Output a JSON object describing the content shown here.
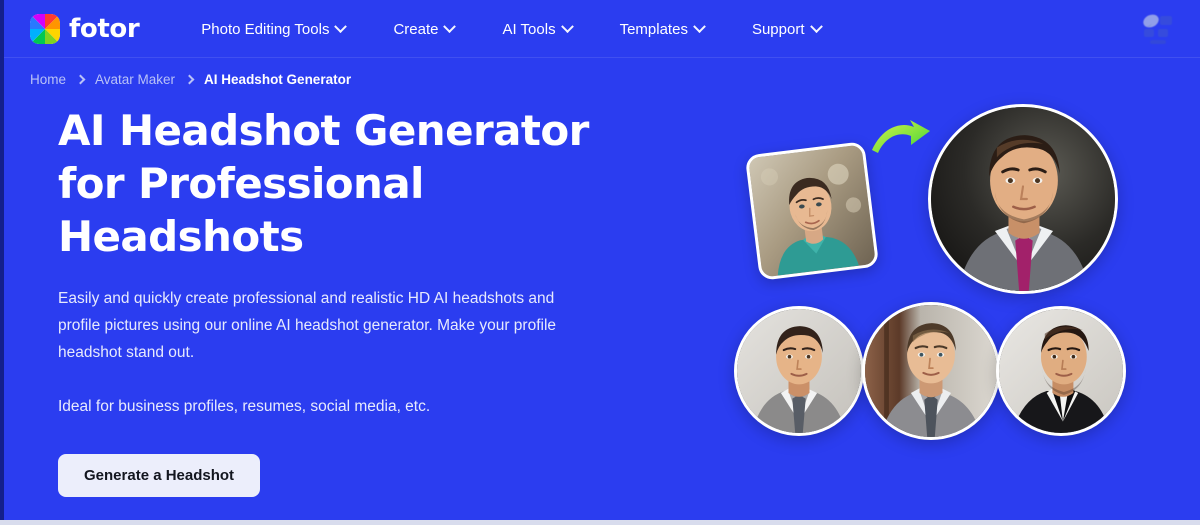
{
  "colors": {
    "background": "#2B3DF0",
    "header_bg": "#2B3DF0",
    "text_primary": "#FFFFFF",
    "text_muted": "#B9C2F7",
    "cta_bg": "#ECEEFB",
    "cta_text": "#13161F",
    "arrow_green": "#5FE03A",
    "arrow_green_light": "#C8F24A"
  },
  "header": {
    "brand_name": "fotor",
    "brand_icon": "fotor-color-wheel-logo",
    "nav_items": [
      {
        "label": "Photo Editing Tools",
        "icon": "chevron-down-icon",
        "has_dropdown": true
      },
      {
        "label": "Create",
        "icon": "chevron-down-icon",
        "has_dropdown": true
      },
      {
        "label": "AI Tools",
        "icon": "chevron-down-icon",
        "has_dropdown": true
      },
      {
        "label": "Templates",
        "icon": "chevron-down-icon",
        "has_dropdown": true
      },
      {
        "label": "Support",
        "icon": "chevron-down-icon",
        "has_dropdown": true
      }
    ],
    "account_icon": "user-avatar-icon"
  },
  "breadcrumb": {
    "separator_icon": "chevron-right-icon",
    "items": [
      {
        "label": "Home",
        "current": false
      },
      {
        "label": "Avatar Maker",
        "current": false
      },
      {
        "label": "AI Headshot Generator",
        "current": true
      }
    ]
  },
  "hero": {
    "title": "AI Headshot Generator for Professional Headshots",
    "description": "Easily and quickly create professional and realistic HD AI headshots and profile pictures using our online AI headshot generator. Make your profile headshot stand out.",
    "subtext": "Ideal for business profiles, resumes, social media, etc.",
    "cta_label": "Generate a Headshot"
  },
  "collage": {
    "source_photo_alt": "casual-photo-of-man-in-teal-shirt",
    "arrow_icon": "curved-green-arrow-icon",
    "main_result_alt": "professional-headshot-dark-background-purple-tie",
    "results": [
      {
        "alt": "headshot-grey-suit-light-background"
      },
      {
        "alt": "headshot-grey-suit-wood-background"
      },
      {
        "alt": "headshot-black-blazer-white-shirt"
      }
    ]
  }
}
